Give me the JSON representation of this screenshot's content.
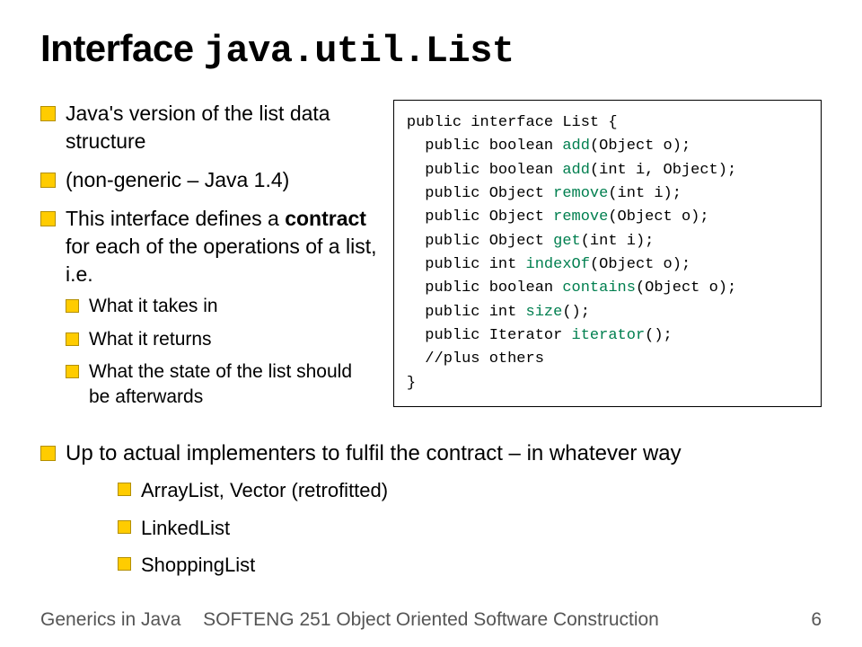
{
  "title_prefix": "Interface ",
  "title_code": "java.util.List",
  "left_bullets": [
    {
      "text": "Java's version of the list data structure"
    },
    {
      "text": "(non-generic – Java 1.4)"
    },
    {
      "html": "This interface defines a <span class=\"bold\">contract</span> for each of the operations of a list, i.e.",
      "sub": [
        "What it takes in",
        "What it returns",
        "What the state of the list should be afterwards"
      ]
    }
  ],
  "below_bullets": [
    {
      "text": "Up to actual implementers to fulfil the contract – in whatever way",
      "sub": [
        "ArrayList, Vector (retrofitted)",
        "LinkedList",
        "ShoppingList"
      ]
    }
  ],
  "code": {
    "open": "public interface List {",
    "lines": [
      {
        "pre": "  public boolean ",
        "name": "add",
        "post": "(Object o);"
      },
      {
        "pre": "  public boolean ",
        "name": "add",
        "post": "(int i, Object);"
      },
      {
        "pre": "  public Object ",
        "name": "remove",
        "post": "(int i);"
      },
      {
        "pre": "  public Object ",
        "name": "remove",
        "post": "(Object o);"
      },
      {
        "pre": "  public Object ",
        "name": "get",
        "post": "(int i);"
      },
      {
        "pre": "  public int ",
        "name": "indexOf",
        "post": "(Object o);"
      },
      {
        "pre": "  public boolean ",
        "name": "contains",
        "post": "(Object o);"
      },
      {
        "pre": "  public int ",
        "name": "size",
        "post": "();"
      },
      {
        "pre": "  public Iterator ",
        "name": "iterator",
        "post": "();"
      }
    ],
    "comment": "  //plus others",
    "close": "}"
  },
  "footer": {
    "left": "Generics in Java",
    "center": "SOFTENG 251 Object Oriented Software Construction",
    "right": "6"
  }
}
